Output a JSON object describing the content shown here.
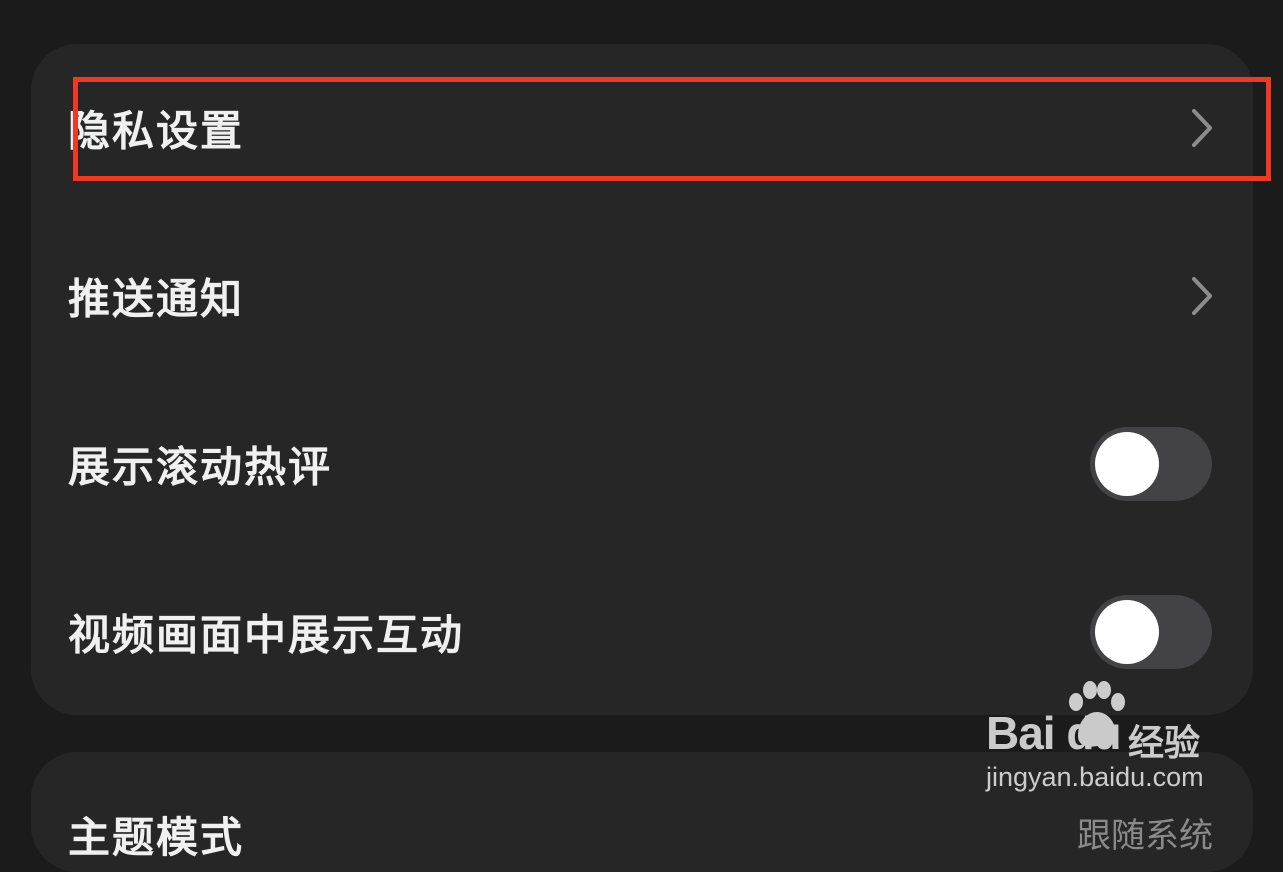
{
  "settings": {
    "rows": [
      {
        "label": "隐私设置",
        "control": "chevron",
        "control_icon": "chevron-right-icon"
      },
      {
        "label": "推送通知",
        "control": "chevron",
        "control_icon": "chevron-right-icon"
      },
      {
        "label": "展示滚动热评",
        "control": "toggle",
        "toggle_on": false
      },
      {
        "label": "视频画面中展示互动",
        "control": "toggle",
        "toggle_on": false
      }
    ],
    "next_section": {
      "label": "主题模式",
      "value": "跟随系统"
    }
  },
  "watermark": {
    "brand": "Bai du",
    "product": "经验",
    "url": "jingyan.baidu.com",
    "icon": "paw-icon"
  },
  "colors": {
    "background": "#1b1b1c",
    "card": "#262627",
    "text": "#f0f0f0",
    "chevron": "#8c8c8c",
    "toggle_track_off": "#434345",
    "toggle_knob": "#ffffff",
    "highlight": "#ee3a24"
  }
}
